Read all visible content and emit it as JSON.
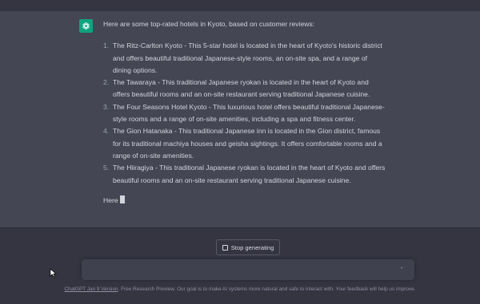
{
  "response": {
    "intro": "Here are some top-rated hotels in Kyoto, based on customer reviews:",
    "items": [
      {
        "num": "1.",
        "text": "The Ritz-Carlton Kyoto - This 5-star hotel is located in the heart of Kyoto's historic district and offers beautiful traditional Japanese-style rooms, an on-site spa, and a range of dining options."
      },
      {
        "num": "2.",
        "text": "The Tawaraya - This traditional Japanese ryokan is located in the heart of Kyoto and offers beautiful rooms and an on-site restaurant serving traditional Japanese cuisine."
      },
      {
        "num": "3.",
        "text": "The Four Seasons Hotel Kyoto - This luxurious hotel offers beautiful traditional Japanese-style rooms and a range of on-site amenities, including a spa and fitness center."
      },
      {
        "num": "4.",
        "text": "The Gion Hatanaka - This traditional Japanese inn is located in the Gion district, famous for its traditional machiya houses and geisha sightings. It offers comfortable rooms and a range of on-site amenities."
      },
      {
        "num": "5.",
        "text": "The Hiiragiya - This traditional Japanese ryokan is located in the heart of Kyoto and offers beautiful rooms and an on-site restaurant serving traditional Japanese cuisine."
      }
    ],
    "partial": "Here"
  },
  "controls": {
    "stop_label": "Stop generating"
  },
  "input": {
    "value": ""
  },
  "footer": {
    "link": "ChatGPT Jan 9 Version",
    "text": ". Free Research Preview. Our goal is to make AI systems more natural and safe to interact with. Your feedback will help us improve."
  },
  "icons": {
    "avatar": "openai-logo-icon",
    "stop": "stop-square-icon",
    "send": "send-icon",
    "pointer": "mouse-pointer-icon"
  },
  "colors": {
    "accent": "#10a37f",
    "response_bg": "#444654",
    "page_bg": "#343541"
  }
}
